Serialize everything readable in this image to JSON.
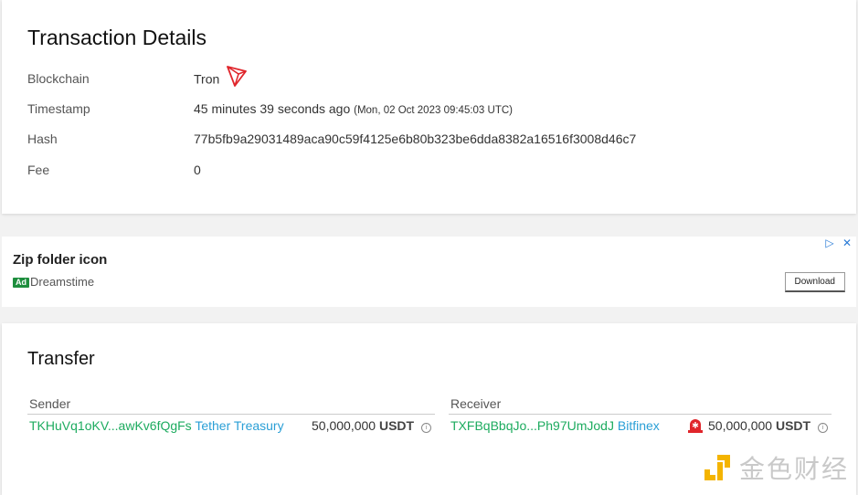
{
  "transaction": {
    "title": "Transaction Details",
    "rows": [
      {
        "label": "Blockchain",
        "value": "Tron"
      },
      {
        "label": "Timestamp",
        "value": "45 minutes 39 seconds ago",
        "detail": "(Mon, 02 Oct 2023 09:45:03 UTC)"
      },
      {
        "label": "Hash",
        "value": "77b5fb9a29031489aca90c59f4125e6b80b323be6dda8382a16516f3008d46c7"
      },
      {
        "label": "Fee",
        "value": "0"
      }
    ]
  },
  "ad": {
    "title": "Zip folder icon",
    "badge": "Ad",
    "source": "Dreamstime",
    "button": "Download",
    "controls": "▷ ✕"
  },
  "transfer": {
    "title": "Transfer",
    "sender": {
      "header": "Sender",
      "address": "TKHuVq1oKV...awKv6fQgFs",
      "tag": "Tether Treasury",
      "amount": "50,000,000",
      "token": "USDT"
    },
    "receiver": {
      "header": "Receiver",
      "address": "TXFBqBbqJo...Ph97UmJodJ",
      "tag": "Bitfinex",
      "amount": "50,000,000",
      "token": "USDT"
    }
  },
  "watermark": {
    "text": "金色财经"
  },
  "colors": {
    "link": "#1dab5f",
    "tag": "#2a9fd6",
    "tron": "#e0252b"
  }
}
